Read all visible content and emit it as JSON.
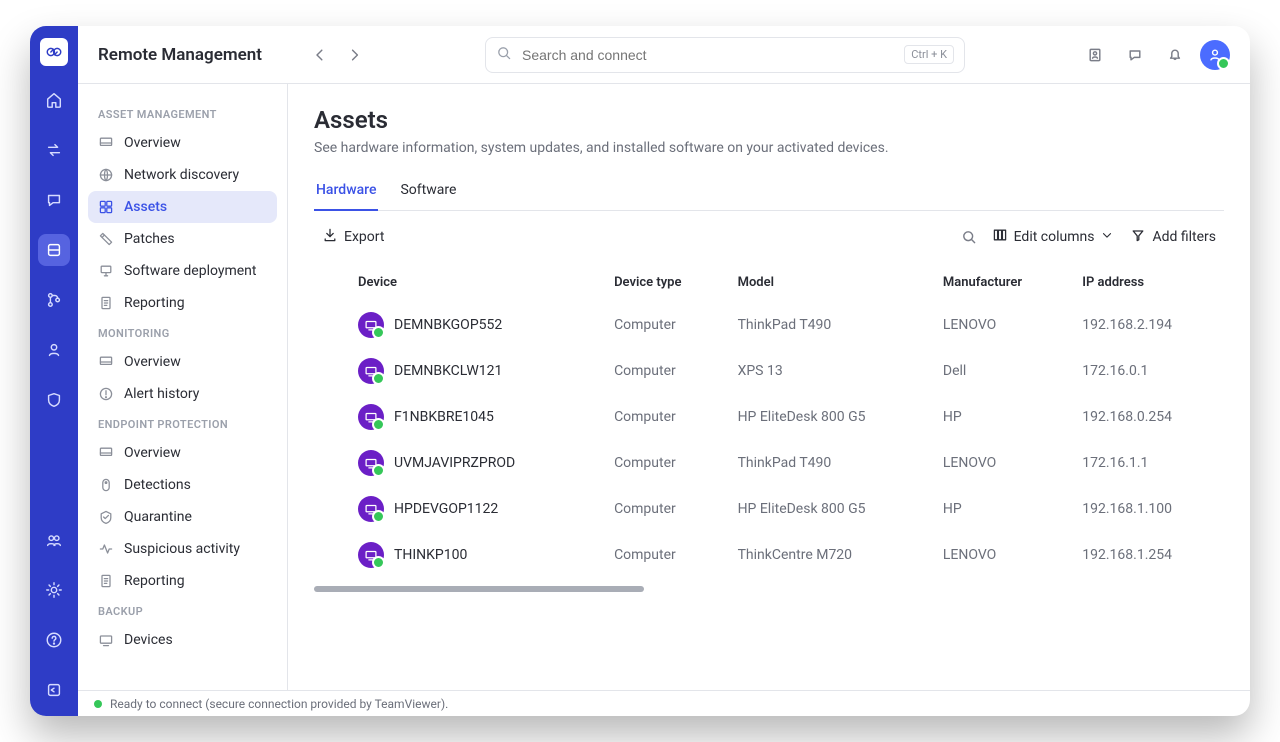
{
  "header": {
    "app_title": "Remote Management",
    "search_placeholder": "Search and connect",
    "shortcut": "Ctrl + K"
  },
  "sidebar": {
    "sections": [
      {
        "title": "ASSET MANAGEMENT",
        "items": [
          {
            "label": "Overview",
            "icon": "dashboard-icon"
          },
          {
            "label": "Network discovery",
            "icon": "network-icon"
          },
          {
            "label": "Assets",
            "icon": "grid-icon",
            "active": true
          },
          {
            "label": "Patches",
            "icon": "patch-icon"
          },
          {
            "label": "Software deployment",
            "icon": "deploy-icon"
          },
          {
            "label": "Reporting",
            "icon": "report-icon"
          }
        ]
      },
      {
        "title": "MONITORING",
        "items": [
          {
            "label": "Overview",
            "icon": "dashboard-icon"
          },
          {
            "label": "Alert history",
            "icon": "alert-icon"
          }
        ]
      },
      {
        "title": "ENDPOINT PROTECTION",
        "items": [
          {
            "label": "Overview",
            "icon": "dashboard-icon"
          },
          {
            "label": "Detections",
            "icon": "detection-icon"
          },
          {
            "label": "Quarantine",
            "icon": "quarantine-icon"
          },
          {
            "label": "Suspicious activity",
            "icon": "activity-icon"
          },
          {
            "label": "Reporting",
            "icon": "report-icon"
          }
        ]
      },
      {
        "title": "BACKUP",
        "items": [
          {
            "label": "Devices",
            "icon": "devices-icon"
          }
        ]
      }
    ]
  },
  "page": {
    "title": "Assets",
    "subtitle": "See hardware information, system updates, and installed software on your activated devices."
  },
  "tabs": [
    {
      "label": "Hardware",
      "active": true
    },
    {
      "label": "Software"
    }
  ],
  "toolbar": {
    "export_label": "Export",
    "edit_columns_label": "Edit columns",
    "add_filters_label": "Add filters"
  },
  "table": {
    "columns": [
      "Device",
      "Device type",
      "Model",
      "Manufacturer",
      "IP address"
    ],
    "rows": [
      {
        "device": "DEMNBKGOP552",
        "type": "Computer",
        "model": "ThinkPad T490",
        "manufacturer": "LENOVO",
        "ip": "192.168.2.194"
      },
      {
        "device": "DEMNBKCLW121",
        "type": "Computer",
        "model": "XPS 13",
        "manufacturer": "Dell",
        "ip": "172.16.0.1"
      },
      {
        "device": "F1NBKBRE1045",
        "type": "Computer",
        "model": "HP EliteDesk 800 G5",
        "manufacturer": "HP",
        "ip": "192.168.0.254"
      },
      {
        "device": "UVMJAVIPRZPROD",
        "type": "Computer",
        "model": "ThinkPad T490",
        "manufacturer": "LENOVO",
        "ip": "172.16.1.1"
      },
      {
        "device": "HPDEVGOP1122",
        "type": "Computer",
        "model": "HP EliteDesk 800 G5",
        "manufacturer": "HP",
        "ip": "192.168.1.100"
      },
      {
        "device": "THINKP100",
        "type": "Computer",
        "model": "ThinkCentre M720",
        "manufacturer": "LENOVO",
        "ip": "192.168.1.254"
      }
    ]
  },
  "status": {
    "text": "Ready to connect (secure connection provided by TeamViewer)."
  }
}
